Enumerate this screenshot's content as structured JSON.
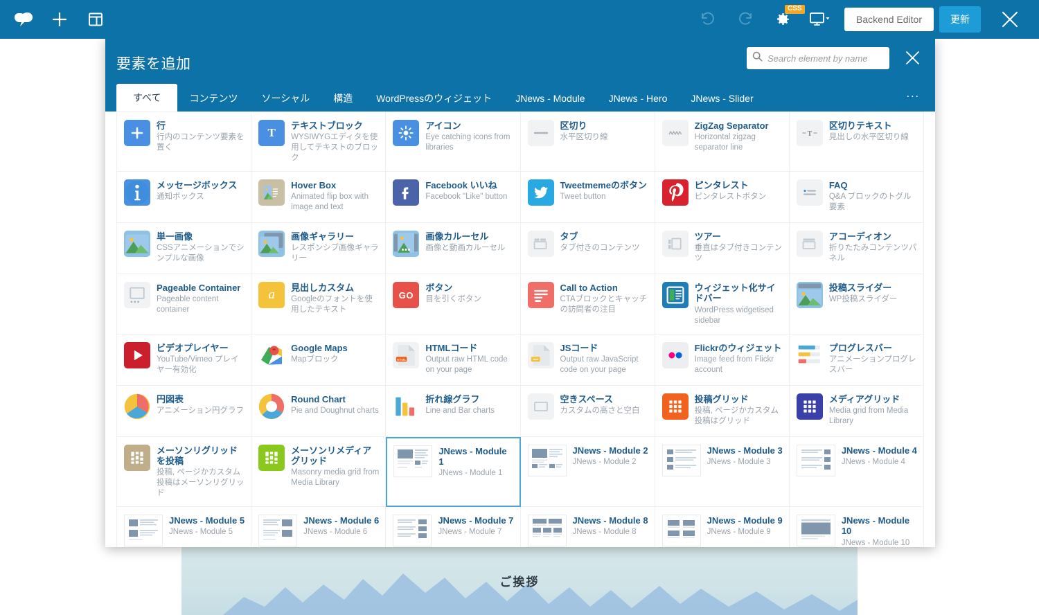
{
  "toolbar": {
    "logo_icon": "cloud-logo-icon",
    "add_icon": "plus-icon",
    "layout_icon": "layout-template-icon",
    "undo_icon": "undo-icon",
    "redo_icon": "redo-icon",
    "settings_icon": "gear-icon",
    "css_badge": "CSS",
    "responsive_icon": "monitor-icon",
    "backend_editor_label": "Backend Editor",
    "update_label": "更新",
    "close_icon": "close-icon",
    "bar_color": "#0d72a8",
    "update_color": "#1e9cd7"
  },
  "modal": {
    "title": "要素を追加",
    "close_icon": "close-icon",
    "search": {
      "placeholder": "Search element by name",
      "value": "",
      "icon": "search-icon"
    },
    "more_tabs_label": "...",
    "tabs": [
      {
        "label": "すべて",
        "active": true
      },
      {
        "label": "コンテンツ",
        "active": false
      },
      {
        "label": "ソーシャル",
        "active": false
      },
      {
        "label": "構造",
        "active": false
      },
      {
        "label": "WordPressのウィジェット",
        "active": false
      },
      {
        "label": "JNews - Module",
        "active": false
      },
      {
        "label": "JNews - Hero",
        "active": false
      },
      {
        "label": "JNews - Slider",
        "active": false
      }
    ]
  },
  "elements": [
    {
      "name": "行",
      "desc": "行内のコンテンツ要素を置く",
      "icon": "plus-square-icon",
      "icon_bg": "#4a90e2",
      "selected": false
    },
    {
      "name": "テキストブロック",
      "desc": "WYSIWYGエディタを使用してテキストのブロック",
      "icon": "text-t-icon",
      "icon_bg": "#4a90e2",
      "selected": false
    },
    {
      "name": "アイコン",
      "desc": "Eye catching icons from libraries",
      "icon": "sun-star-icon",
      "icon_bg": "#4a90e2",
      "selected": false
    },
    {
      "name": "区切り",
      "desc": "水平区切り線",
      "icon": "separator-line-icon",
      "icon_bg": "#f0f2f4",
      "selected": false
    },
    {
      "name": "ZigZag Separator",
      "desc": "Horizontal zigzag separator line",
      "icon": "zigzag-icon",
      "icon_bg": "#f0f2f4",
      "selected": false
    },
    {
      "name": "区切りテキスト",
      "desc": "見出しの水平区切り線",
      "icon": "separator-text-icon",
      "icon_bg": "#f0f2f4",
      "selected": false
    },
    {
      "name": "メッセージボックス",
      "desc": "通知ボックス",
      "icon": "info-circle-icon",
      "icon_bg": "#4a90e2",
      "selected": false
    },
    {
      "name": "Hover Box",
      "desc": "Animated flip box with image and text",
      "icon": "hover-box-icon",
      "icon_bg": "#c9bfa4",
      "selected": false
    },
    {
      "name": "Facebook いいね",
      "desc": "Facebook \"Like\" button",
      "icon": "facebook-icon",
      "icon_bg": "#4a63a9",
      "selected": false
    },
    {
      "name": "Tweetmemeのボタン",
      "desc": "Tweet button",
      "icon": "twitter-icon",
      "icon_bg": "#29a9e1",
      "selected": false
    },
    {
      "name": "ピンタレスト",
      "desc": "ピンタレストボタン",
      "icon": "pinterest-icon",
      "icon_bg": "#d8232f",
      "selected": false
    },
    {
      "name": "FAQ",
      "desc": "Q&A ブロックのトグル要素",
      "icon": "faq-list-icon",
      "icon_bg": "#f0f2f4",
      "selected": false
    },
    {
      "name": "単一画像",
      "desc": "CSSアニメーションでシンプルな画像",
      "icon": "image-icon",
      "icon_bg": "#8ec1e6",
      "selected": false
    },
    {
      "name": "画像ギャラリー",
      "desc": "レスポンシブ画像ギャラリー",
      "icon": "image-stack-icon",
      "icon_bg": "#8ec1e6",
      "selected": false
    },
    {
      "name": "画像カルーセル",
      "desc": "画像と動画カルーセル",
      "icon": "image-carousel-icon",
      "icon_bg": "#8ec1e6",
      "selected": false
    },
    {
      "name": "タブ",
      "desc": "タブ付きのコンテンツ",
      "icon": "tabs-icon",
      "icon_bg": "#f0f2f4",
      "selected": false
    },
    {
      "name": "ツアー",
      "desc": "垂直はタブ付きコンテンツ",
      "icon": "tour-icon",
      "icon_bg": "#f0f2f4",
      "selected": false
    },
    {
      "name": "アコーディオン",
      "desc": "折りたたみコンテンツパネル",
      "icon": "accordion-icon",
      "icon_bg": "#f0f2f4",
      "selected": false
    },
    {
      "name": "Pageable Container",
      "desc": "Pageable content container",
      "icon": "pageable-container-icon",
      "icon_bg": "#f0f2f4",
      "selected": false
    },
    {
      "name": "見出しカスタム",
      "desc": "Googleのフォントを使用したテキスト",
      "icon": "custom-heading-a-icon",
      "icon_bg": "#f5c33b",
      "selected": false
    },
    {
      "name": "ボタン",
      "desc": "目を引くボタン",
      "icon": "go-button-icon",
      "icon_bg": "#e8504a",
      "selected": false
    },
    {
      "name": "Call to Action",
      "desc": "CTAブロックとキャッチの訪問者の注目",
      "icon": "call-to-action-icon",
      "icon_bg": "#ef6e68",
      "selected": false
    },
    {
      "name": "ウィジェット化サイドバー",
      "desc": "WordPress widgetised sidebar",
      "icon": "sidebar-widget-icon",
      "icon_bg": "#1f7cb4",
      "selected": false
    },
    {
      "name": "投稿スライダー",
      "desc": "WP投稿スライダー",
      "icon": "post-slider-icon",
      "icon_bg": "#8ec1e6",
      "selected": false
    },
    {
      "name": "ビデオプレイヤー",
      "desc": "YouTube/Vimeo プレイヤー有効化",
      "icon": "play-circle-icon",
      "icon_bg": "#cc1f2d",
      "selected": false
    },
    {
      "name": "Google Maps",
      "desc": "Mapブロック",
      "icon": "google-maps-icon",
      "icon_bg": "#ffffff",
      "selected": false
    },
    {
      "name": "HTMLコード",
      "desc": "Output raw HTML code on your page",
      "icon": "html-file-icon",
      "icon_bg": "#f0f2f4",
      "selected": false
    },
    {
      "name": "JSコード",
      "desc": "Output raw JavaScript code on your page",
      "icon": "js-file-icon",
      "icon_bg": "#f0f2f4",
      "selected": false
    },
    {
      "name": "Flickrのウィジェット",
      "desc": "Image feed from Flickr account",
      "icon": "flickr-icon",
      "icon_bg": "#eceef0",
      "selected": false
    },
    {
      "name": "プログレスバー",
      "desc": "アニメーションプログレスバー",
      "icon": "progress-bars-icon",
      "icon_bg": "#ffffff",
      "selected": false
    },
    {
      "name": "円図表",
      "desc": "アニメーション円グラフ",
      "icon": "pie-chart-icon",
      "icon_bg": "#ffffff",
      "selected": false
    },
    {
      "name": "Round Chart",
      "desc": "Pie and Doughnut charts",
      "icon": "doughnut-chart-icon",
      "icon_bg": "#ffffff",
      "selected": false
    },
    {
      "name": "折れ線グラフ",
      "desc": "Line and Bar charts",
      "icon": "bar-chart-icon",
      "icon_bg": "#ffffff",
      "selected": false
    },
    {
      "name": "空きスペース",
      "desc": "カスタムの高さと空白",
      "icon": "empty-space-icon",
      "icon_bg": "#f0f2f4",
      "selected": false
    },
    {
      "name": "投稿グリッド",
      "desc": "投稿, ページかカスタム投稿はグリッド",
      "icon": "post-grid-icon",
      "icon_bg": "#f2621f",
      "selected": false
    },
    {
      "name": "メディアグリッド",
      "desc": "Media grid from Media Library",
      "icon": "media-grid-icon",
      "icon_bg": "#3b3fa8",
      "selected": false
    },
    {
      "name": "メーソンリグリッドを投稿",
      "desc": "投稿, ページかカスタム投稿はメーソンリグリッド",
      "icon": "masonry-post-grid-icon",
      "icon_bg": "#c0ae8b",
      "selected": false
    },
    {
      "name": "メーソンリメディアグリッド",
      "desc": "Masonry media grid from Media Library",
      "icon": "masonry-media-grid-icon",
      "icon_bg": "#8ac81e",
      "selected": false
    }
  ],
  "jnews_modules": [
    {
      "name": "JNews - Module 1",
      "desc": "JNews - Module 1",
      "thumb": "module-1-thumb",
      "selected": true
    },
    {
      "name": "JNews - Module 2",
      "desc": "JNews - Module 2",
      "thumb": "module-2-thumb",
      "selected": false
    },
    {
      "name": "JNews - Module 3",
      "desc": "JNews - Module 3",
      "thumb": "module-3-thumb",
      "selected": false
    },
    {
      "name": "JNews - Module 4",
      "desc": "JNews - Module 4",
      "thumb": "module-4-thumb",
      "selected": false
    },
    {
      "name": "JNews - Module 5",
      "desc": "JNews - Module 5",
      "thumb": "module-5-thumb",
      "selected": false
    },
    {
      "name": "JNews - Module 6",
      "desc": "JNews - Module 6",
      "thumb": "module-6-thumb",
      "selected": false
    },
    {
      "name": "JNews - Module 7",
      "desc": "JNews - Module 7",
      "thumb": "module-7-thumb",
      "selected": false
    },
    {
      "name": "JNews - Module 8",
      "desc": "JNews - Module 8",
      "thumb": "module-8-thumb",
      "selected": false
    },
    {
      "name": "JNews - Module 9",
      "desc": "JNews - Module 9",
      "thumb": "module-9-thumb",
      "selected": false
    },
    {
      "name": "JNews - Module 10",
      "desc": "JNews - Module 10",
      "thumb": "module-10-thumb",
      "selected": false
    }
  ],
  "background_page": {
    "hero_text": "ご挨拶"
  }
}
